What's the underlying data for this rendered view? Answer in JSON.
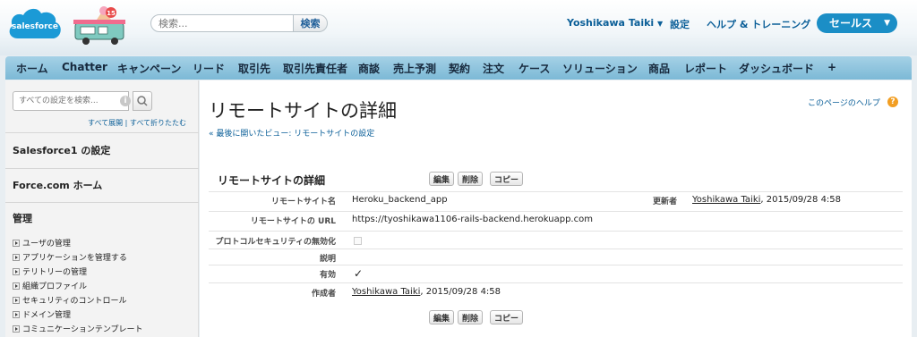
{
  "header": {
    "logo_text": "salesforce",
    "search": {
      "placeholder": "検索...",
      "button_label": "検索"
    },
    "user_name": "Yoshikawa Taiki",
    "setup_label": "設定",
    "help_label": "ヘルプ & トレーニング",
    "app_menu_label": "セールス",
    "truck_badge": "15"
  },
  "tabs": [
    "ホーム",
    "Chatter",
    "キャンペーン",
    "リード",
    "取引先",
    "取引先責任者",
    "商談",
    "売上予測",
    "契約",
    "注文",
    "ケース",
    "ソリューション",
    "商品",
    "レポート",
    "ダッシュボード",
    "+"
  ],
  "sidebar": {
    "search_placeholder": "すべての設定を検索...",
    "expand_all": "すべて展開",
    "separator": "|",
    "collapse_all": "すべて折りたたむ",
    "sections": [
      "Salesforce1 の設定",
      "Force.com ホーム",
      "管理"
    ],
    "admin_items": [
      "ユーザの管理",
      "アプリケーションを管理する",
      "テリトリーの管理",
      "組織プロファイル",
      "セキュリティのコントロール",
      "ドメイン管理",
      "コミュニケーションテンプレート"
    ]
  },
  "main": {
    "page_title": "リモートサイトの詳細",
    "back_link": "« 最後に開いたビュー: リモートサイトの設定",
    "help_link": "このページのヘルプ",
    "section_title": "リモートサイトの詳細",
    "buttons": {
      "edit": "編集",
      "delete": "削除",
      "copy": "コピー"
    },
    "fields": {
      "name_label": "リモートサイト名",
      "name_value": "Heroku_backend_app",
      "updated_by_label": "更新者",
      "updated_by_user": "Yoshikawa Taiki",
      "updated_by_date": ", 2015/09/28 4:58",
      "url_label": "リモートサイトの URL",
      "url_value": "https://tyoshikawa1106-rails-backend.herokuapp.com",
      "protocol_label": "プロトコルセキュリティの無効化",
      "protocol_value": false,
      "description_label": "説明",
      "description_value": "",
      "active_label": "有効",
      "active_value": "✓",
      "created_by_label": "作成者",
      "created_by_user": "Yoshikawa Taiki",
      "created_by_date": ", 2015/09/28 4:58"
    }
  },
  "colors": {
    "brand": "#1b8ec6",
    "tabbar": "#7cb9d6",
    "link": "#0b5f98",
    "help_icon": "#f29e22"
  }
}
